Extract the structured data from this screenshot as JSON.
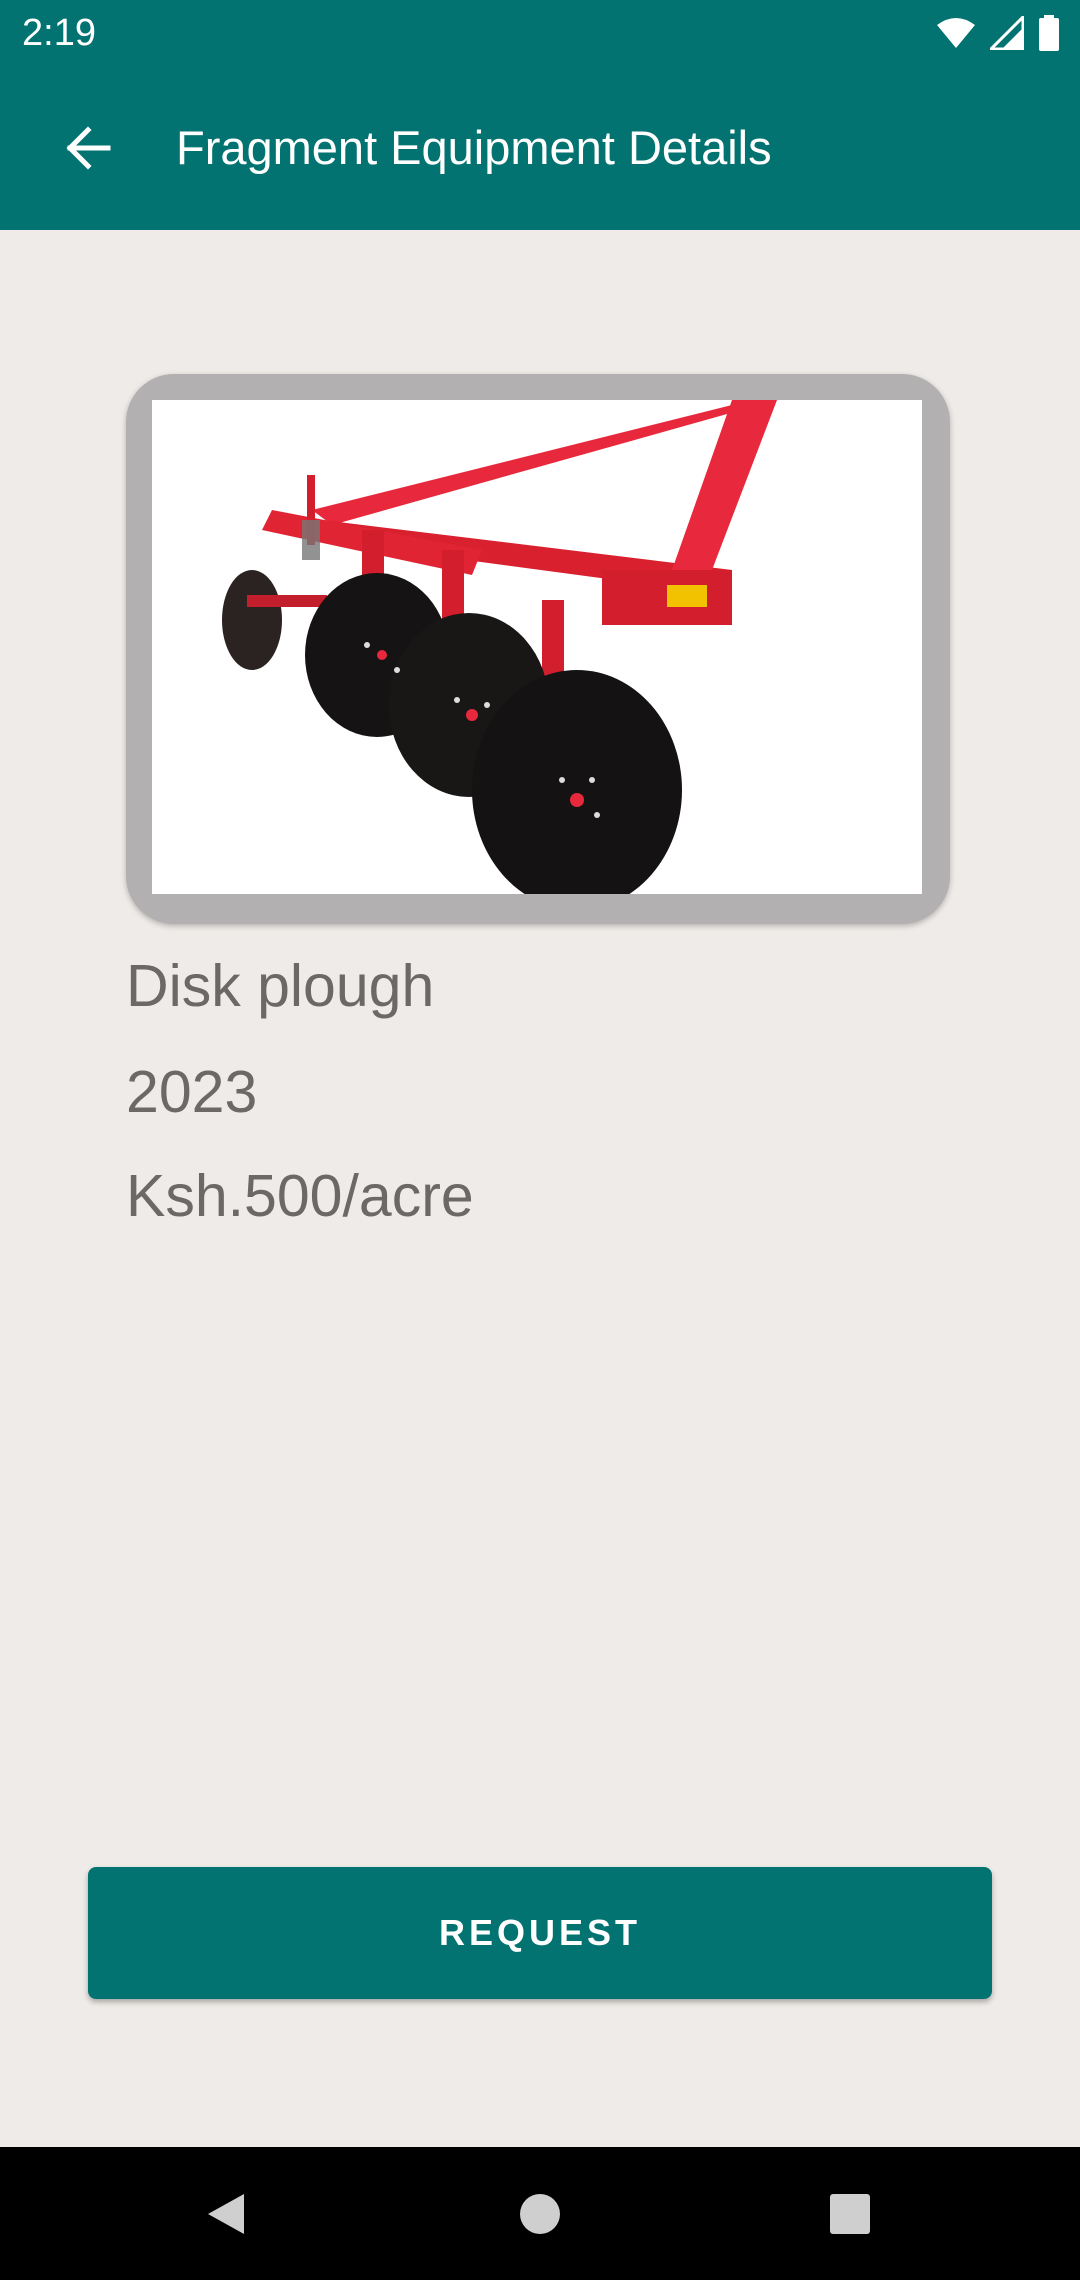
{
  "status_bar": {
    "time": "2:19",
    "icons": [
      "wifi-icon",
      "signal-icon",
      "battery-icon"
    ]
  },
  "app_bar": {
    "title": "Fragment Equipment Details",
    "back_icon": "arrow-back-icon"
  },
  "equipment": {
    "image_subject": "disk-plough-image",
    "name": "Disk plough",
    "year": "2023",
    "price": "Ksh.500/acre"
  },
  "actions": {
    "request_label": "REQUEST"
  },
  "nav_bar": {
    "icons": [
      "back-triangle-icon",
      "home-circle-icon",
      "recents-square-icon"
    ]
  },
  "colors": {
    "primary": "#037372",
    "background": "#efebe8",
    "text_secondary": "#6b6866",
    "plough_red": "#e8283c"
  }
}
